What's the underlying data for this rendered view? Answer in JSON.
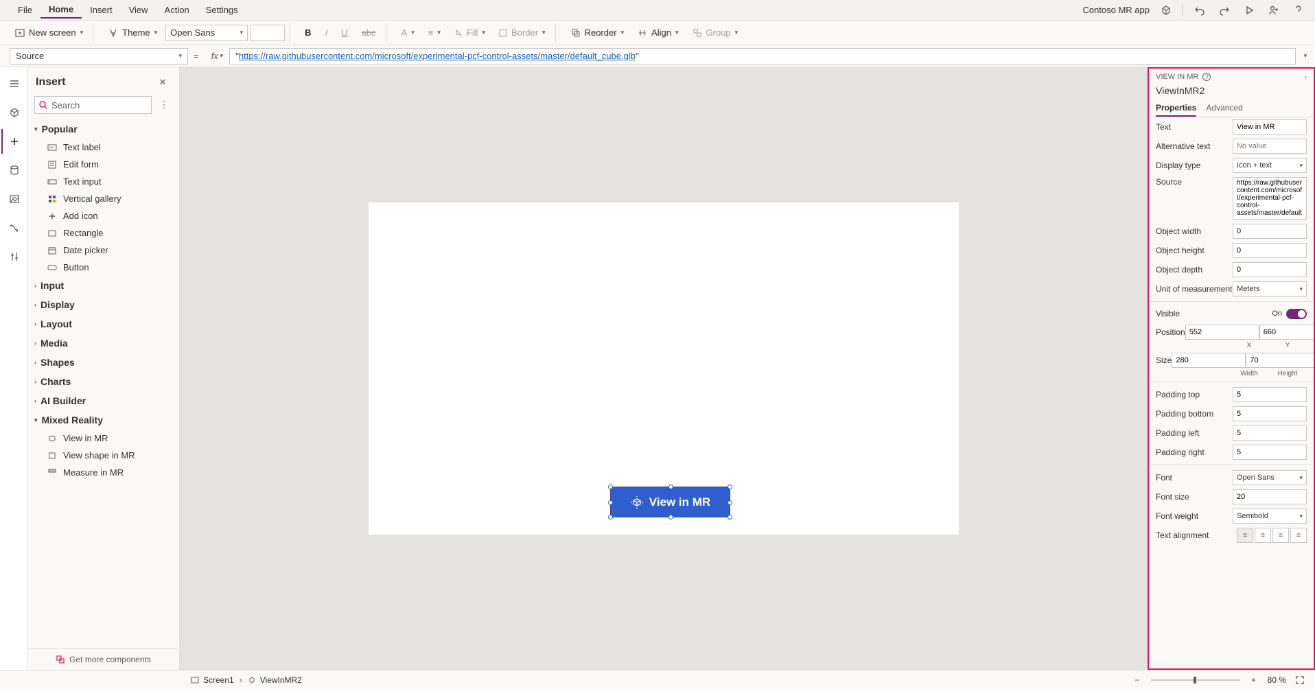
{
  "app_name": "Contoso MR app",
  "menu_tabs": [
    "File",
    "Home",
    "Insert",
    "View",
    "Action",
    "Settings"
  ],
  "menu_active_index": 1,
  "toolbar": {
    "new_screen": "New screen",
    "theme": "Theme",
    "font": "Open Sans",
    "fill": "Fill",
    "border": "Border",
    "reorder": "Reorder",
    "align": "Align",
    "group": "Group"
  },
  "formula": {
    "property": "Source",
    "value": "https://raw.githubusercontent.com/microsoft/experimental-pcf-control-assets/master/default_cube.glb"
  },
  "insert": {
    "title": "Insert",
    "search_placeholder": "Search",
    "popular_label": "Popular",
    "popular_items": [
      "Text label",
      "Edit form",
      "Text input",
      "Vertical gallery",
      "Add icon",
      "Rectangle",
      "Date picker",
      "Button"
    ],
    "categories": [
      "Input",
      "Display",
      "Layout",
      "Media",
      "Shapes",
      "Charts",
      "AI Builder",
      "Mixed Reality"
    ],
    "mr_items": [
      "View in MR",
      "View shape in MR",
      "Measure in MR"
    ],
    "get_more": "Get more components"
  },
  "canvas_control": {
    "label": "View in MR"
  },
  "props": {
    "header": "VIEW IN MR",
    "name": "ViewInMR2",
    "tabs": [
      "Properties",
      "Advanced"
    ],
    "text_label": "Text",
    "text_value": "View in MR",
    "alt_label": "Alternative text",
    "alt_placeholder": "No value",
    "display_label": "Display type",
    "display_value": "Icon + text",
    "source_label": "Source",
    "source_value": "https://raw.githubusercontent.com/microsoft/experimental-pcf-control-assets/master/default_",
    "owidth_label": "Object width",
    "owidth_value": "0",
    "oheight_label": "Object height",
    "oheight_value": "0",
    "odepth_label": "Object depth",
    "odepth_value": "0",
    "unit_label": "Unit of measurement",
    "unit_value": "Meters",
    "visible_label": "Visible",
    "visible_value": "On",
    "position_label": "Position",
    "pos_x": "552",
    "pos_y": "660",
    "pos_xl": "X",
    "pos_yl": "Y",
    "size_label": "Size",
    "size_w": "280",
    "size_h": "70",
    "size_wl": "Width",
    "size_hl": "Height",
    "ptop_label": "Padding top",
    "ptop_value": "5",
    "pbot_label": "Padding bottom",
    "pbot_value": "5",
    "pleft_label": "Padding left",
    "pleft_value": "5",
    "pright_label": "Padding right",
    "pright_value": "5",
    "font_label": "Font",
    "font_value": "Open Sans",
    "fsize_label": "Font size",
    "fsize_value": "20",
    "fweight_label": "Font weight",
    "fweight_value": "Semibold",
    "talign_label": "Text alignment"
  },
  "status": {
    "screen": "Screen1",
    "control": "ViewInMR2",
    "zoom": "80 %"
  }
}
